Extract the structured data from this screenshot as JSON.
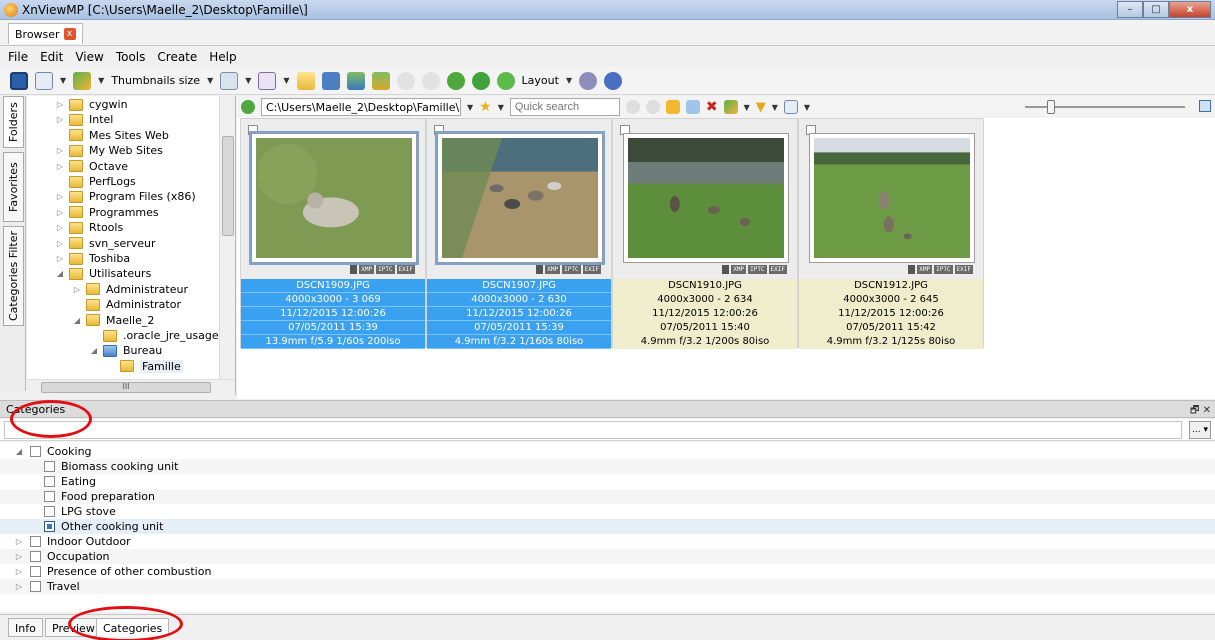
{
  "window": {
    "title": "XnViewMP [C:\\Users\\Maelle_2\\Desktop\\Famille\\]",
    "controls": {
      "minimize": "–",
      "maximize": "□",
      "close": "x"
    }
  },
  "doc_tab": {
    "label": "Browser",
    "close": "x"
  },
  "menu": [
    "File",
    "Edit",
    "View",
    "Tools",
    "Create",
    "Help"
  ],
  "toolbar": {
    "thumbnails_size": "Thumbnails size",
    "layout": "Layout"
  },
  "side_tabs": [
    "Folders",
    "Favorites",
    "Categories Filter"
  ],
  "tree": [
    {
      "label": "cygwin",
      "depth": 1,
      "arrow": "▷"
    },
    {
      "label": "Intel",
      "depth": 1,
      "arrow": "▷"
    },
    {
      "label": "Mes Sites Web",
      "depth": 1,
      "arrow": ""
    },
    {
      "label": "My Web Sites",
      "depth": 1,
      "arrow": "▷"
    },
    {
      "label": "Octave",
      "depth": 1,
      "arrow": "▷"
    },
    {
      "label": "PerfLogs",
      "depth": 1,
      "arrow": ""
    },
    {
      "label": "Program Files (x86)",
      "depth": 1,
      "arrow": "▷"
    },
    {
      "label": "Programmes",
      "depth": 1,
      "arrow": "▷"
    },
    {
      "label": "Rtools",
      "depth": 1,
      "arrow": "▷"
    },
    {
      "label": "svn_serveur",
      "depth": 1,
      "arrow": "▷"
    },
    {
      "label": "Toshiba",
      "depth": 1,
      "arrow": "▷"
    },
    {
      "label": "Utilisateurs",
      "depth": 1,
      "arrow": "◢"
    },
    {
      "label": "Administrateur",
      "depth": 2,
      "arrow": "▷"
    },
    {
      "label": "Administrator",
      "depth": 2,
      "arrow": ""
    },
    {
      "label": "Maelle_2",
      "depth": 2,
      "arrow": "◢"
    },
    {
      "label": ".oracle_jre_usage",
      "depth": 3,
      "arrow": ""
    },
    {
      "label": "Bureau",
      "depth": 3,
      "arrow": "◢",
      "blue": true
    },
    {
      "label": "Famille",
      "depth": 4,
      "arrow": "",
      "selected": true
    }
  ],
  "tree_hscroll_label": "III",
  "address": {
    "path": "C:\\Users\\Maelle_2\\Desktop\\Famille\\",
    "search_placeholder": "Quick search"
  },
  "thumbnails": [
    {
      "filename": "DSCN1909.JPG",
      "dims": "4000x3000 - 3 069",
      "date1": "11/12/2015 12:00:26",
      "date2": "07/05/2011 15:39",
      "exif": "13.9mm f/5.9 1/60s 200iso",
      "selected": true
    },
    {
      "filename": "DSCN1907.JPG",
      "dims": "4000x3000 - 2 630",
      "date1": "11/12/2015 12:00:26",
      "date2": "07/05/2011 15:39",
      "exif": "4.9mm f/3.2 1/160s 80iso",
      "selected": true
    },
    {
      "filename": "DSCN1910.JPG",
      "dims": "4000x3000 - 2 634",
      "date1": "11/12/2015 12:00:26",
      "date2": "07/05/2011 15:40",
      "exif": "4.9mm f/3.2 1/200s 80iso",
      "selected": false
    },
    {
      "filename": "DSCN1912.JPG",
      "dims": "4000x3000 - 2 645",
      "date1": "11/12/2015 12:00:26",
      "date2": "07/05/2011 15:42",
      "exif": "4.9mm f/3.2 1/125s 80iso",
      "selected": false
    }
  ],
  "badge_labels": [
    "XMP",
    "IPTC",
    "EXIF"
  ],
  "categories_panel": {
    "title": "Categories",
    "controls": "🗗 ✕",
    "more_button": "... ▾",
    "items": [
      {
        "label": "Cooking",
        "level": 0,
        "arrow": "◢",
        "checked": false
      },
      {
        "label": "Biomass cooking unit",
        "level": 1,
        "arrow": "",
        "checked": false
      },
      {
        "label": "Eating",
        "level": 1,
        "arrow": "",
        "checked": false
      },
      {
        "label": "Food preparation",
        "level": 1,
        "arrow": "",
        "checked": false
      },
      {
        "label": "LPG stove",
        "level": 1,
        "arrow": "",
        "checked": false
      },
      {
        "label": "Other cooking unit",
        "level": 1,
        "arrow": "",
        "checked": true,
        "selected": true
      },
      {
        "label": "Indoor Outdoor",
        "level": 0,
        "arrow": "▷",
        "checked": false
      },
      {
        "label": "Occupation",
        "level": 0,
        "arrow": "▷",
        "checked": false
      },
      {
        "label": "Presence of other combustion",
        "level": 0,
        "arrow": "▷",
        "checked": false
      },
      {
        "label": "Travel",
        "level": 0,
        "arrow": "▷",
        "checked": false
      }
    ]
  },
  "bottom_tabs": [
    {
      "label": "Info",
      "active": false
    },
    {
      "label": "Preview",
      "active": false
    },
    {
      "label": "Categories",
      "active": true
    }
  ],
  "colors": {
    "selected_info": "#3aa0f0",
    "unselected_info": "#efedcb",
    "annotation": "#e10f14"
  }
}
